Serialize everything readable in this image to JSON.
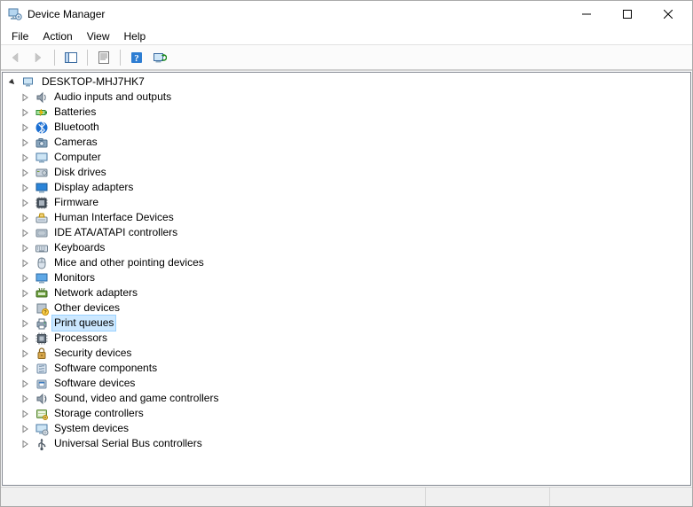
{
  "window": {
    "title": "Device Manager"
  },
  "menu": {
    "file": "File",
    "action": "Action",
    "view": "View",
    "help": "Help"
  },
  "tree": {
    "root": "DESKTOP-MHJ7HK7",
    "children": [
      {
        "icon": "audio",
        "label": "Audio inputs and outputs"
      },
      {
        "icon": "battery",
        "label": "Batteries"
      },
      {
        "icon": "bluetooth",
        "label": "Bluetooth"
      },
      {
        "icon": "camera",
        "label": "Cameras"
      },
      {
        "icon": "computer",
        "label": "Computer"
      },
      {
        "icon": "disk",
        "label": "Disk drives"
      },
      {
        "icon": "display",
        "label": "Display adapters"
      },
      {
        "icon": "firmware",
        "label": "Firmware"
      },
      {
        "icon": "hid",
        "label": "Human Interface Devices"
      },
      {
        "icon": "ide",
        "label": "IDE ATA/ATAPI controllers"
      },
      {
        "icon": "keyboard",
        "label": "Keyboards"
      },
      {
        "icon": "mouse",
        "label": "Mice and other pointing devices"
      },
      {
        "icon": "monitor",
        "label": "Monitors"
      },
      {
        "icon": "network",
        "label": "Network adapters"
      },
      {
        "icon": "other",
        "label": "Other devices"
      },
      {
        "icon": "printer",
        "label": "Print queues",
        "selected": true
      },
      {
        "icon": "processor",
        "label": "Processors"
      },
      {
        "icon": "security",
        "label": "Security devices"
      },
      {
        "icon": "swcomp",
        "label": "Software components"
      },
      {
        "icon": "swdev",
        "label": "Software devices"
      },
      {
        "icon": "sound",
        "label": "Sound, video and game controllers"
      },
      {
        "icon": "storage",
        "label": "Storage controllers"
      },
      {
        "icon": "system",
        "label": "System devices"
      },
      {
        "icon": "usb",
        "label": "Universal Serial Bus controllers"
      }
    ]
  },
  "colors": {
    "selection_bg": "#cce8ff",
    "selection_border": "#99d1ff"
  }
}
